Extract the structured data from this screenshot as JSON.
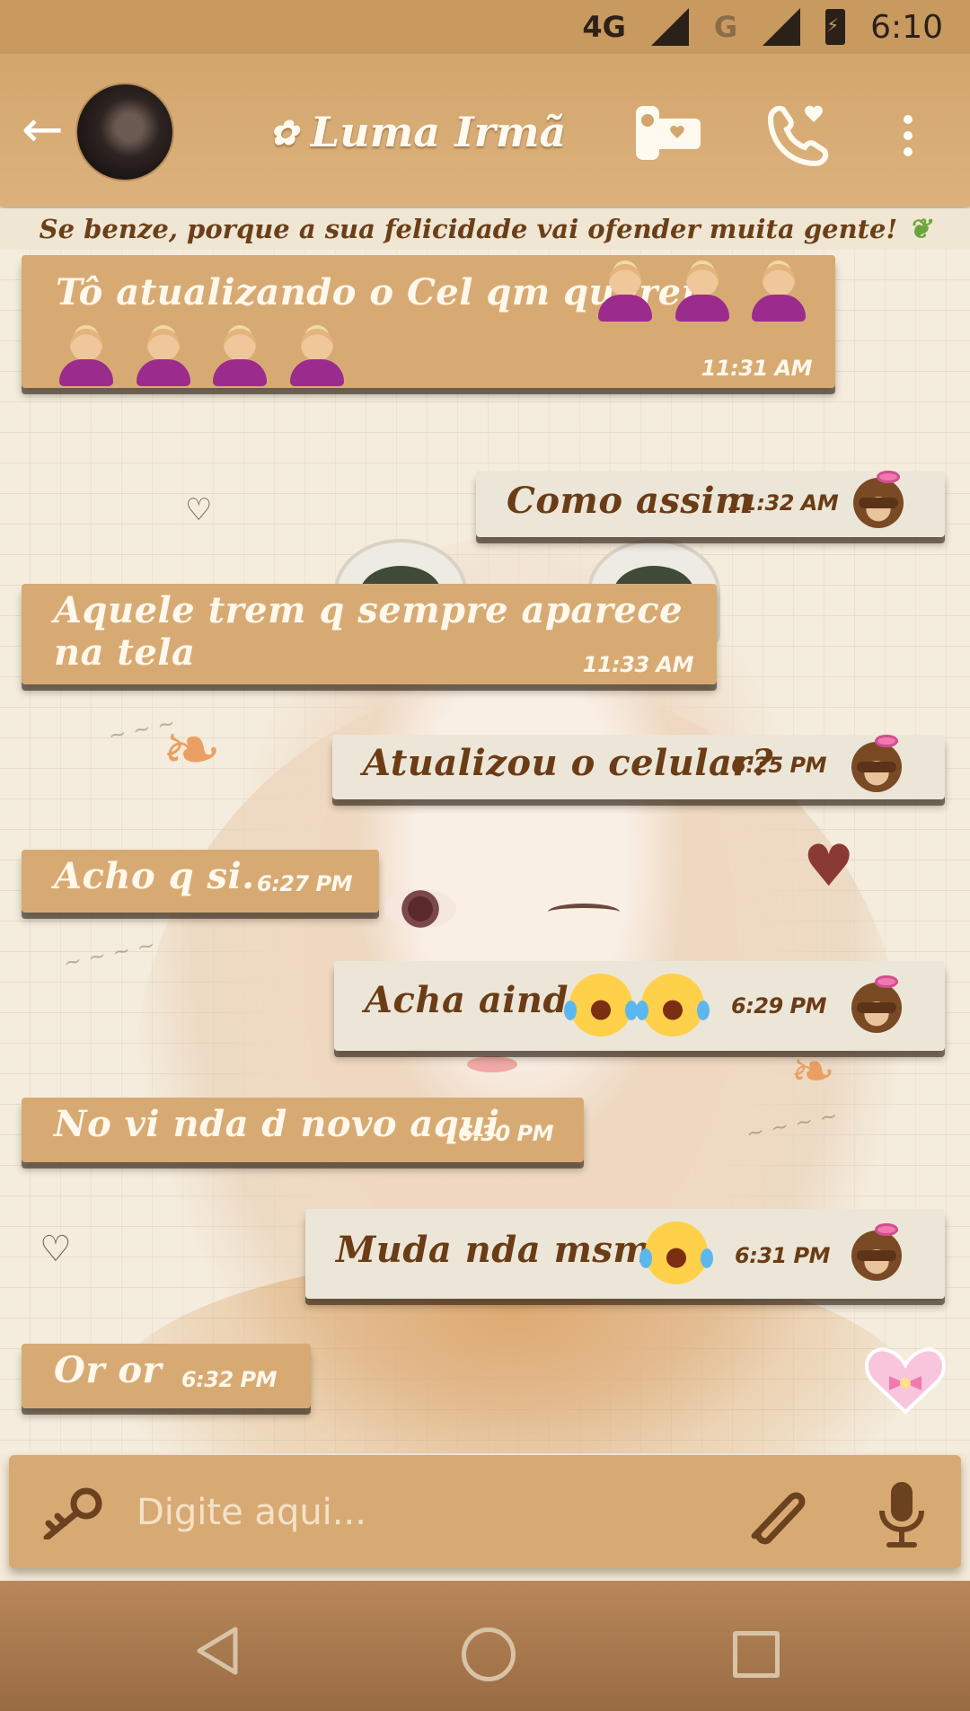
{
  "status_bar": {
    "network_primary": "4G",
    "network_secondary": "G",
    "time": "6:10"
  },
  "header": {
    "contact_name": "Luma Irmã",
    "name_prefix_icon": "flower-icon",
    "icons": [
      "back-arrow-icon",
      "video-call-icon",
      "phone-heart-icon",
      "more-options-icon"
    ]
  },
  "banner": {
    "text": "Se benze, porque a sua felicidade vai ofender muita gente!",
    "icon": "leaf-icon"
  },
  "messages": [
    {
      "direction": "in",
      "text": "Tô atualizando o Cel qm querer",
      "emojis": 7,
      "emoji_icon": "facepalm-icon",
      "time": "11:31 AM"
    },
    {
      "direction": "out",
      "text": "Como assim",
      "time": "11:32 AM",
      "status_icon": "monkey-icon"
    },
    {
      "direction": "in",
      "text": "Aquele trem q sempre aparece na tela",
      "time": "11:33 AM"
    },
    {
      "direction": "out",
      "text": "Atualizou o celular?",
      "time": "6:25 PM",
      "status_icon": "monkey-icon"
    },
    {
      "direction": "in",
      "text": "Acho q si.",
      "time": "6:27 PM"
    },
    {
      "direction": "out",
      "text": "Acha ainda",
      "emojis": 2,
      "emoji_icon": "laughing-tears-icon",
      "time": "6:29 PM",
      "status_icon": "monkey-icon"
    },
    {
      "direction": "in",
      "text": "No vi nda d novo aqui",
      "time": "6:30 PM"
    },
    {
      "direction": "out",
      "text": "Muda nda msm n",
      "emojis": 1,
      "emoji_icon": "laughing-tears-icon",
      "time": "6:31 PM",
      "status_icon": "monkey-icon"
    },
    {
      "direction": "in",
      "text": "Or or",
      "time": "6:32 PM"
    }
  ],
  "input_bar": {
    "placeholder": "Digite aqui...",
    "icons": [
      "key-icon",
      "attach-icon",
      "mic-icon"
    ]
  },
  "floating_icon": "pink-heart-icon",
  "nav_bar": {
    "icons": [
      "nav-back-icon",
      "nav-home-icon",
      "nav-recent-icon"
    ]
  },
  "colors": {
    "header_bg": "#d3a66d",
    "incoming_bubble": "#d8aa73",
    "outgoing_bubble": "#ece6d8",
    "outgoing_text": "#6b3c15",
    "nav_bg": "#9a6c43"
  }
}
